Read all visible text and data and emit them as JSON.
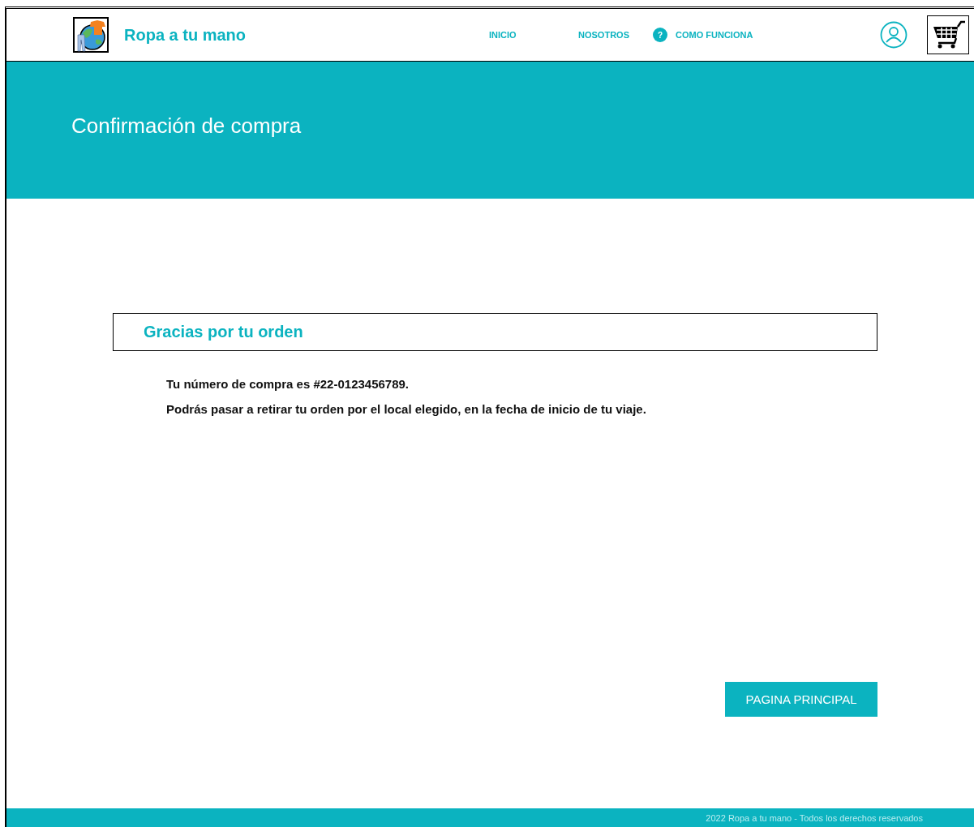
{
  "header": {
    "brand": "Ropa a tu mano",
    "nav": [
      {
        "label": "INICIO"
      },
      {
        "label": "NOSOTROS"
      },
      {
        "label": "COMO FUNCIONA",
        "help": "?"
      }
    ]
  },
  "banner": {
    "title": "Confirmación de compra"
  },
  "order": {
    "heading": "Gracias por tu orden",
    "lines": [
      "Tu número de compra es #22-0123456789.",
      "Podrás pasar a retirar tu orden por el local elegido, en la fecha de inicio de tu viaje."
    ]
  },
  "button": "PAGINA PRINCIPAL",
  "footer": "2022 Ropa a tu mano - Todos los derechos reservados"
}
